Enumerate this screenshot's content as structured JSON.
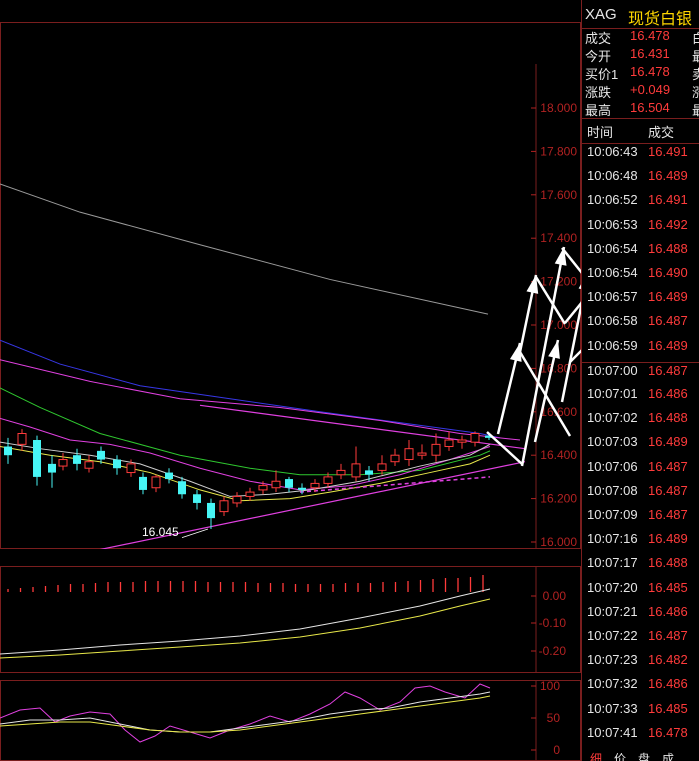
{
  "symbol": {
    "code": "XAG",
    "name": "现货白银"
  },
  "quote": [
    {
      "label": "成交",
      "value": "16.478",
      "extra": "白"
    },
    {
      "label": "今开",
      "value": "16.431",
      "extra": "最"
    },
    {
      "label": "买价1",
      "value": "16.478",
      "extra": "卖"
    },
    {
      "label": "涨跌",
      "value": "+0.049",
      "extra": "涨"
    },
    {
      "label": "最高",
      "value": "16.504",
      "extra": "最"
    }
  ],
  "trades_header": {
    "time": "时间",
    "price": "成交"
  },
  "trades": [
    {
      "time": "10:06:43",
      "price": "16.491"
    },
    {
      "time": "10:06:48",
      "price": "16.489"
    },
    {
      "time": "10:06:52",
      "price": "16.491"
    },
    {
      "time": "10:06:53",
      "price": "16.492"
    },
    {
      "time": "10:06:54",
      "price": "16.488"
    },
    {
      "time": "10:06:54",
      "price": "16.490"
    },
    {
      "time": "10:06:57",
      "price": "16.489"
    },
    {
      "time": "10:06:58",
      "price": "16.487"
    },
    {
      "time": "10:06:59",
      "price": "16.489"
    },
    {
      "time": "10:07:00",
      "price": "16.487"
    },
    {
      "time": "10:07:01",
      "price": "16.486"
    },
    {
      "time": "10:07:02",
      "price": "16.488"
    },
    {
      "time": "10:07:03",
      "price": "16.489"
    },
    {
      "time": "10:07:06",
      "price": "16.487"
    },
    {
      "time": "10:07:08",
      "price": "16.487"
    },
    {
      "time": "10:07:09",
      "price": "16.487"
    },
    {
      "time": "10:07:16",
      "price": "16.489"
    },
    {
      "time": "10:07:17",
      "price": "16.488"
    },
    {
      "time": "10:07:20",
      "price": "16.485"
    },
    {
      "time": "10:07:21",
      "price": "16.486"
    },
    {
      "time": "10:07:22",
      "price": "16.487"
    },
    {
      "time": "10:07:23",
      "price": "16.482"
    },
    {
      "time": "10:07:32",
      "price": "16.486"
    },
    {
      "time": "10:07:33",
      "price": "16.485"
    },
    {
      "time": "10:07:41",
      "price": "16.478"
    }
  ],
  "bottom_tabs": [
    "细",
    "价",
    "盘",
    "成"
  ],
  "chart_data": [
    {
      "type": "line",
      "ylim": [
        15.85,
        18.25
      ],
      "yticks": [
        "18.000",
        "17.800",
        "17.600",
        "17.400",
        "17.200",
        "17.000",
        "16.800",
        "16.600",
        "16.400",
        "16.200",
        "16.000"
      ],
      "annotations": [
        "16.045"
      ],
      "colors": {
        "up": "#ff3b3b",
        "down": "#47f5f5",
        "ma_white": "#cfcfcf",
        "ma_yellow": "#e8e84a",
        "ma_magenta": "#e040e0",
        "ma_green": "#2fc72f",
        "ma_blue": "#3737e6",
        "ma_gray": "#9a9a9a",
        "trendline": "#e040e0",
        "arrows": "#ffffff"
      }
    },
    {
      "type": "bar",
      "yticks": [
        "0.00",
        "-0.10",
        "-0.20"
      ]
    },
    {
      "type": "line",
      "yticks": [
        "100",
        "50",
        "0"
      ]
    }
  ]
}
